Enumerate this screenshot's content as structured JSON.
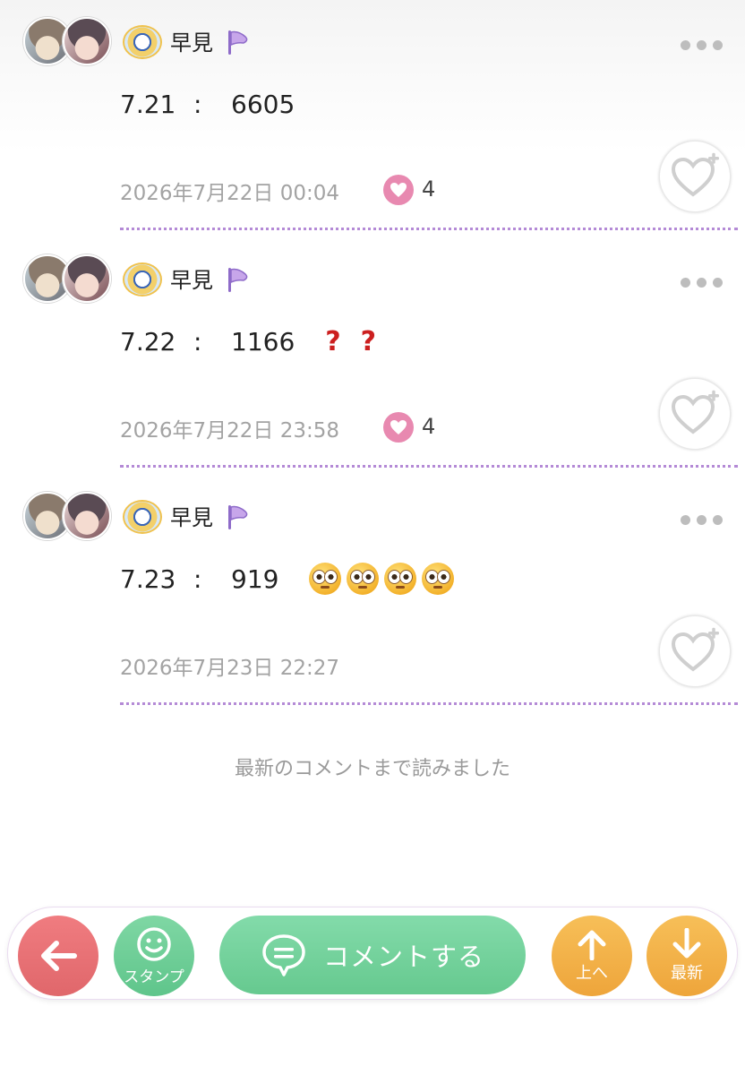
{
  "comments": [
    {
      "username": "早見",
      "date_part": "7.21",
      "separator": ":",
      "count": "6605",
      "timestamp": "2026年7月22日 00:04",
      "likes": "4",
      "decorations": []
    },
    {
      "username": "早見",
      "date_part": "7.22",
      "separator": ":",
      "count": "1166",
      "timestamp": "2026年7月22日 23:58",
      "likes": "4",
      "decorations": [
        "question-mark",
        "question-mark"
      ]
    },
    {
      "username": "早見",
      "date_part": "7.23",
      "separator": ":",
      "count": "919",
      "timestamp": "2026年7月23日 22:27",
      "likes": "",
      "decorations": [
        "flushed-face",
        "flushed-face",
        "flushed-face",
        "flushed-face"
      ]
    }
  ],
  "end_note": "最新のコメントまで読みました",
  "toolbar": {
    "back_icon": "arrow-left-icon",
    "stamp_label": "スタンプ",
    "comment_label": "コメントする",
    "up_label": "上へ",
    "latest_label": "最新"
  },
  "colors": {
    "divider": "#b48ad6",
    "like": "#e889b0",
    "back": "#e86f73",
    "green": "#6fcf97",
    "orange": "#f2b047",
    "question": "#cc1f1f"
  }
}
